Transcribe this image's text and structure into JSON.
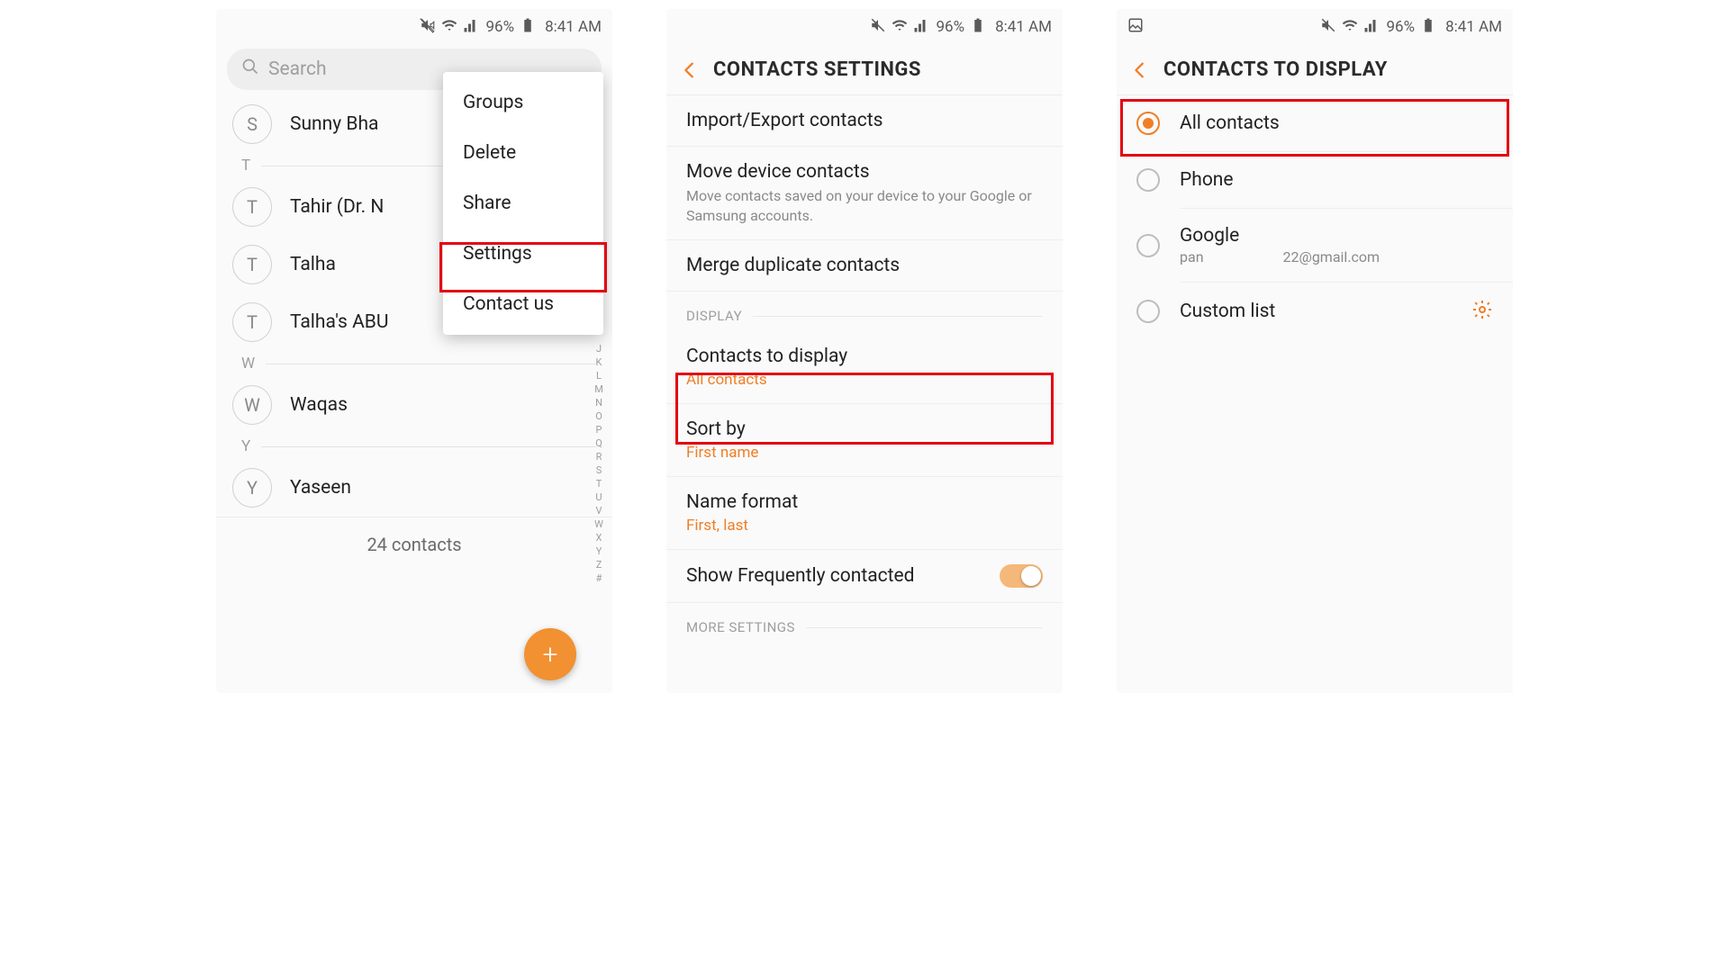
{
  "status": {
    "battery": "96%",
    "time": "8:41 AM"
  },
  "screen1": {
    "search_placeholder": "Search",
    "contacts": [
      {
        "initial": "S",
        "name": "Sunny Bha"
      },
      {
        "initial": "T",
        "name": "Tahir (Dr. N"
      },
      {
        "initial": "T",
        "name": "Talha"
      },
      {
        "initial": "T",
        "name": "Talha's ABU"
      },
      {
        "initial": "W",
        "name": "Waqas"
      },
      {
        "initial": "Y",
        "name": "Yaseen"
      }
    ],
    "sections": {
      "t": "T",
      "w": "W",
      "y": "Y"
    },
    "footer": "24 contacts",
    "index_letters": "J K L M N O P Q R S T U V W X Y Z #",
    "menu": {
      "groups": "Groups",
      "delete": "Delete",
      "share": "Share",
      "settings": "Settings",
      "contact_us": "Contact us"
    }
  },
  "screen2": {
    "title": "CONTACTS SETTINGS",
    "import_export": "Import/Export contacts",
    "move_title": "Move device contacts",
    "move_desc": "Move contacts saved on your device to your Google or Samsung accounts.",
    "merge": "Merge duplicate contacts",
    "display_header": "DISPLAY",
    "contacts_to_display": "Contacts to display",
    "contacts_to_display_value": "All contacts",
    "sort_by": "Sort by",
    "sort_by_value": "First name",
    "name_format": "Name format",
    "name_format_value": "First, last",
    "show_freq": "Show Frequently contacted",
    "more_settings": "MORE SETTINGS"
  },
  "screen3": {
    "title": "CONTACTS TO DISPLAY",
    "opt_all": "All contacts",
    "opt_phone": "Phone",
    "opt_google": "Google",
    "opt_google_sub_left": "pan",
    "opt_google_sub_right": "22@gmail.com",
    "opt_custom": "Custom list"
  }
}
